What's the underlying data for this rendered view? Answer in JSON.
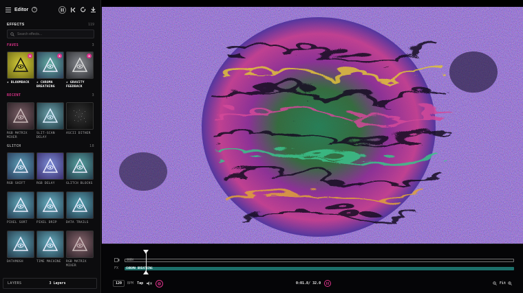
{
  "topbar": {
    "title": "Editor",
    "help_glyph": "?",
    "icons": [
      "menu-icon",
      "help-icon",
      "pause-icon",
      "skip-start-icon",
      "refresh-icon",
      "download-icon"
    ]
  },
  "effects": {
    "title": "EFFECTS",
    "count": "119",
    "search_placeholder": "Search effects..."
  },
  "sections": {
    "faves": {
      "title": "FAVES",
      "count": "3",
      "items": [
        {
          "label": "★ BLOOMBACK",
          "colors": [
            "#d8cf3a",
            "#6e6a17"
          ]
        },
        {
          "label": "★ CHROMA BREATHING",
          "colors": [
            "#67b2a8",
            "#2b3e58"
          ]
        },
        {
          "label": "★ GRAVITY FEEDBACK",
          "colors": [
            "#8a8d92",
            "#2e2f33"
          ]
        }
      ]
    },
    "recent": {
      "title": "RECENT",
      "count": "3",
      "items": [
        {
          "label": "RGB MATRIX MIXER",
          "colors": [
            "#7a5f66",
            "#2a2025"
          ]
        },
        {
          "label": "SLIT-SCAN DELAY",
          "colors": [
            "#6fa4ad",
            "#1f3943"
          ]
        },
        {
          "label": "ASCII DITHER",
          "colors": [
            "#333333",
            "#0c0c0c"
          ]
        }
      ]
    },
    "glitch": {
      "title": "GLITCH",
      "count": "18",
      "items": [
        {
          "label": "RGB SHIFT",
          "colors": [
            "#5ea0b8",
            "#283a5a"
          ]
        },
        {
          "label": "RGB DELAY",
          "colors": [
            "#7d8ed8",
            "#3a2f6e"
          ]
        },
        {
          "label": "GLITCH BLOCKS",
          "colors": [
            "#59a5a4",
            "#233b4a"
          ]
        },
        {
          "label": "PIXEL SORT",
          "colors": [
            "#63aabb",
            "#243c52"
          ]
        },
        {
          "label": "PIXEL DRIP",
          "colors": [
            "#6ab3c4",
            "#284458"
          ]
        },
        {
          "label": "DATA TRAILS",
          "colors": [
            "#5aa7b6",
            "#233a4c"
          ]
        },
        {
          "label": "DATAMOSH",
          "colors": [
            "#5fa2b5",
            "#233848"
          ]
        },
        {
          "label": "TIME MACHINE",
          "colors": [
            "#68aec0",
            "#25404f"
          ]
        },
        {
          "label": "RGB MATRIX MIXER",
          "colors": [
            "#8a6870",
            "#2c2228"
          ]
        }
      ]
    }
  },
  "layers": {
    "label": "LAYERS",
    "count": "3 Layers"
  },
  "timeline": {
    "source_clip": "OBEN",
    "fx_clip": "CHROMA BREATHING",
    "source_icon": "video-icon",
    "fx_icon": "fx-icon",
    "fx_glyph": "FX"
  },
  "controls": {
    "bpm": "120",
    "bpm_label": "BPM",
    "tap": "Tap",
    "time": "0:01.8/ 32.0",
    "fit": "Fit"
  },
  "colors": {
    "accent": "#e0338c",
    "fx_track": "#1c6f6a",
    "canvas_base": "#3a2fb8"
  }
}
